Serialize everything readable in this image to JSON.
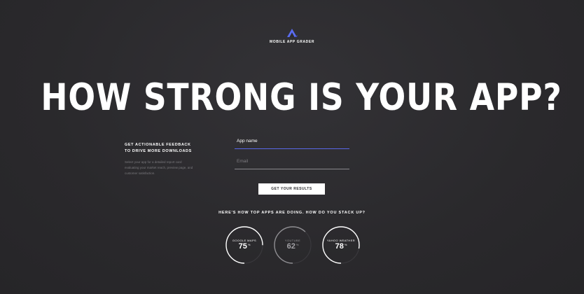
{
  "brand": {
    "name": "MOBILE APP GRADER",
    "logo_icon": "chevron-up-logo-icon",
    "logo_color": "#5a6cf0"
  },
  "headline": "HOW STRONG IS YOUR APP?",
  "info": {
    "title_line1": "GET ACTIONABLE FEEDBACK",
    "title_line2": "TO DRIVE MORE DOWNLOADS",
    "description": "Select your app for a detailed report card evaluating your market reach, preview page, and customer satisfaction."
  },
  "form": {
    "app_name_label": "App name",
    "email_label": "Email",
    "active_underline_color": "#5968e8",
    "submit_label": "GET YOUR RESULTS"
  },
  "comparison": {
    "title": "HERE'S HOW TOP APPS ARE DOING. HOW DO YOU STACK UP?",
    "apps": [
      {
        "name": "GOOGLE MAPS",
        "score": "75",
        "unit": "%",
        "fraction": 0.75
      },
      {
        "name": "YOUTUBE",
        "score": "62",
        "unit": "%",
        "fraction": 0.62
      },
      {
        "name": "YAHOO WEATHER",
        "score": "78",
        "unit": "%",
        "fraction": 0.78
      }
    ]
  },
  "colors": {
    "background": "#2b2a2d",
    "text": "#ffffff",
    "muted_text": "#7a797d"
  }
}
